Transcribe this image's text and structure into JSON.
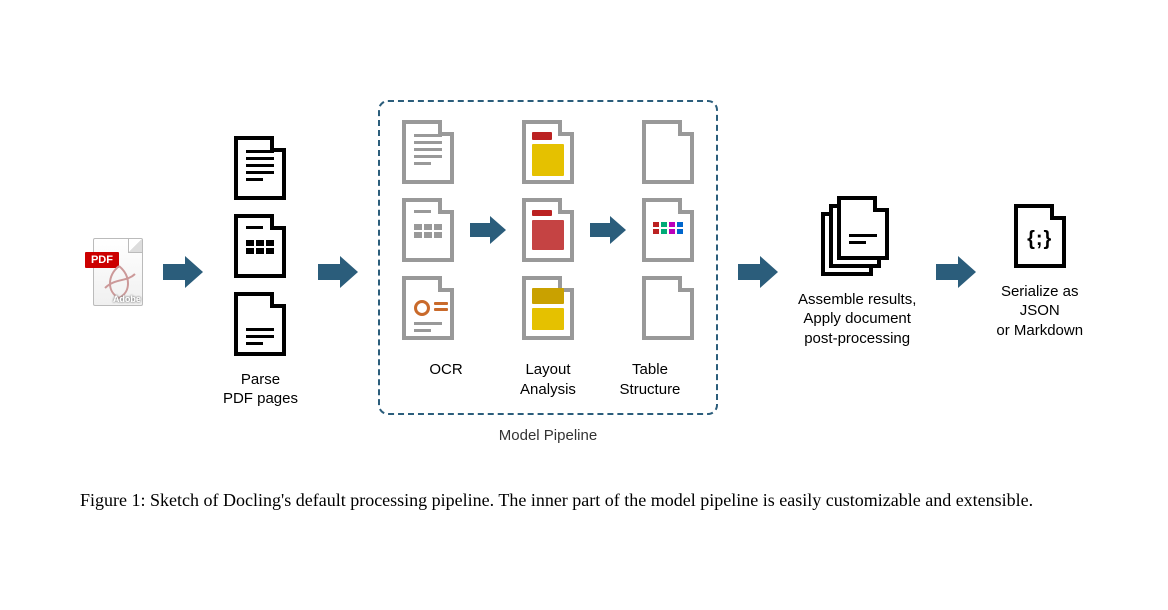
{
  "stages": {
    "input_badge": "PDF",
    "input_vendor": "Adobe",
    "parse": "Parse\nPDF pages",
    "ocr": "OCR",
    "layout": "Layout\nAnalysis",
    "table": "Table\nStructure",
    "pipeline_caption": "Model Pipeline",
    "assemble": "Assemble results,\nApply document\npost-processing",
    "serialize": "Serialize as\nJSON\nor Markdown",
    "json_glyph": "{;}"
  },
  "caption": "Figure 1: Sketch of Docling's default processing pipeline. The inner part of the model pipeline is easily customizable and extensible.",
  "colors": {
    "arrow": "#2b5d7b",
    "dash": "#2b5d7b"
  }
}
